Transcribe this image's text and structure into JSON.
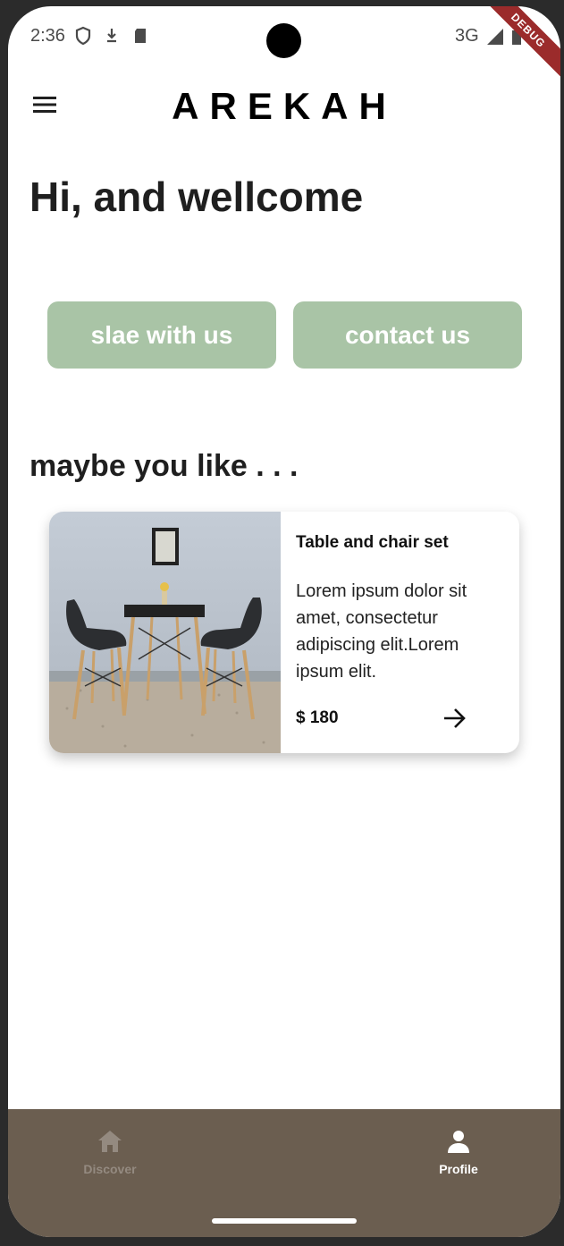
{
  "status_bar": {
    "time": "2:36",
    "network": "3G",
    "debug_label": "DEBUG",
    "icons": [
      "shield-icon",
      "download-icon",
      "sd-card-icon",
      "signal-icon",
      "battery-icon"
    ]
  },
  "app_bar": {
    "brand": "AREKAH",
    "menu_icon": "menu-icon"
  },
  "greeting": "Hi, and wellcome",
  "actions": {
    "sale_label": "slae with us",
    "contact_label": "contact us",
    "button_color": "#a9c4a6"
  },
  "recommendations": {
    "title": "maybe you like . . .",
    "items": [
      {
        "title": "Table and chair set",
        "description": "Lorem ipsum dolor sit amet, consectetur adipiscing elit.Lorem ipsum elit.",
        "price": "$ 180",
        "image": "table-and-chairs-photo"
      }
    ]
  },
  "bottom_nav": {
    "background": "#6b5e50",
    "items": [
      {
        "label": "Discover",
        "icon": "home-icon",
        "active": false
      },
      {
        "label": "Profile",
        "icon": "person-icon",
        "active": true
      }
    ]
  }
}
